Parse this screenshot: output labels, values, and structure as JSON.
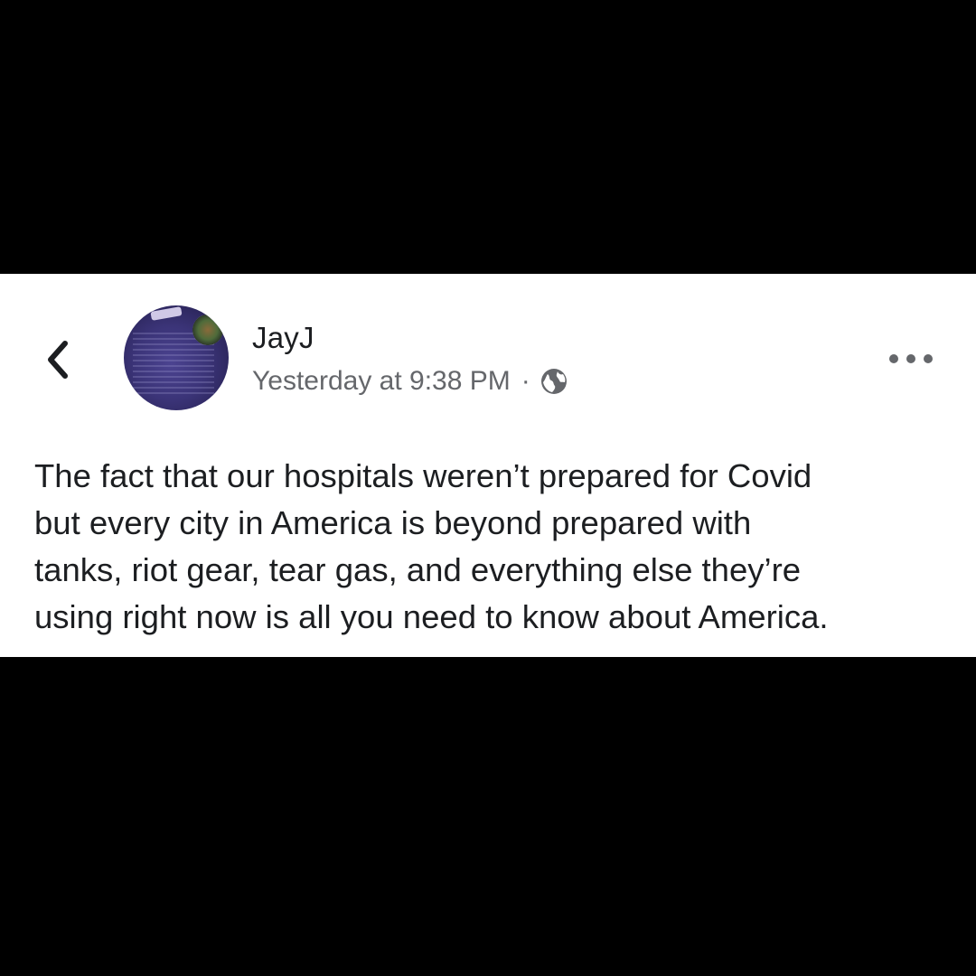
{
  "post": {
    "author_name": "JayJ",
    "timestamp": "Yesterday at 9:38 PM",
    "separator": "·",
    "audience_icon": "globe-icon",
    "text_lines": [
      "The fact that our hospitals weren’t prepared for Covid",
      "but every city in America is beyond prepared with",
      "tanks, riot gear, tear gas, and everything else they’re",
      "using right now is all you need to know about America."
    ]
  },
  "navigation": {
    "back_icon": "chevron-left-icon"
  },
  "actions": {
    "more_icon": "more-horizontal-icon"
  },
  "colors": {
    "background": "#000000",
    "card": "#ffffff",
    "primary_text": "#1c1e21",
    "secondary_text": "#65676b"
  }
}
